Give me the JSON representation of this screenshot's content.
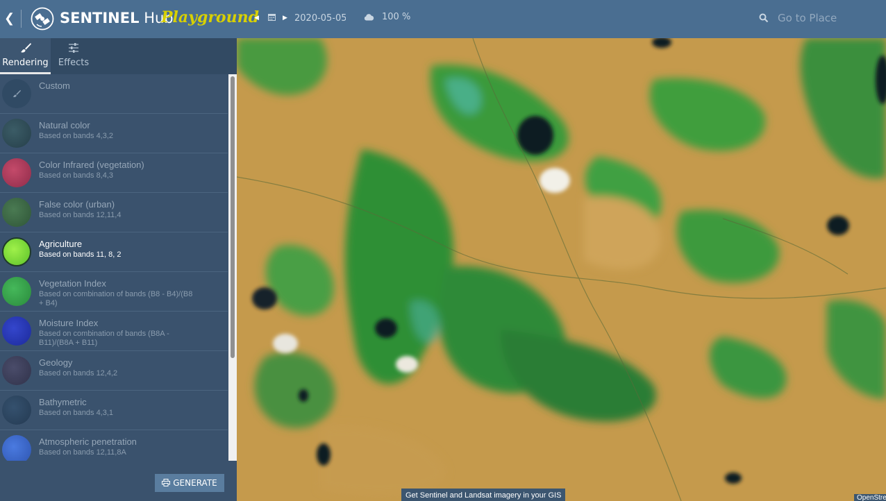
{
  "header": {
    "brand_bold": "SENTINEL",
    "brand_light": "Hub",
    "app_subtitle": "Playground",
    "date_value": "2020-05-05",
    "cloud_coverage": "100 %",
    "search_placeholder": "Go to Place"
  },
  "tabs": [
    {
      "label": "Rendering",
      "icon": "brush-icon",
      "active": true
    },
    {
      "label": "Effects",
      "icon": "sliders-icon",
      "active": false
    }
  ],
  "presets": [
    {
      "name": "Custom",
      "description": "",
      "color": "#304a64",
      "active": false
    },
    {
      "name": "Natural color",
      "description": "Based on bands 4,3,2",
      "color": "#2f4b57",
      "active": false
    },
    {
      "name": "Color Infrared (vegetation)",
      "description": "Based on bands 8,4,3",
      "color": "#b23a5c",
      "active": false
    },
    {
      "name": "False color (urban)",
      "description": "Based on bands 12,11,4",
      "color": "#3e6a48",
      "active": false
    },
    {
      "name": "Agriculture",
      "description": "Based on bands 11, 8, 2",
      "color": "#7ee83a",
      "active": true
    },
    {
      "name": "Vegetation Index",
      "description": "Based on combination of bands (B8 - B4)/(B8 + B4)",
      "color": "#35a548",
      "active": false
    },
    {
      "name": "Moisture Index",
      "description": "Based on combination of bands (B8A - B11)/(B8A + B11)",
      "color": "#2536b8",
      "active": false
    },
    {
      "name": "Geology",
      "description": "Based on bands 12,4,2",
      "color": "#3d3f5c",
      "active": false
    },
    {
      "name": "Bathymetric",
      "description": "Based on bands 4,3,1",
      "color": "#2d4762",
      "active": false
    },
    {
      "name": "Atmospheric penetration",
      "description": "Based on bands 12,11,8A",
      "color": "#3a6ad0",
      "active": false
    }
  ],
  "generate_label": "GENERATE",
  "map": {
    "banner": "Get Sentinel and Landsat imagery in your GIS",
    "credit": "OpenStreetMap"
  },
  "colors": {
    "topbar": "#4a6e91",
    "sidebar": "#3a526d",
    "accent_yellow": "#d8d000",
    "map_vegetation": "#2f8f3a",
    "map_dry": "#c59a4c"
  }
}
